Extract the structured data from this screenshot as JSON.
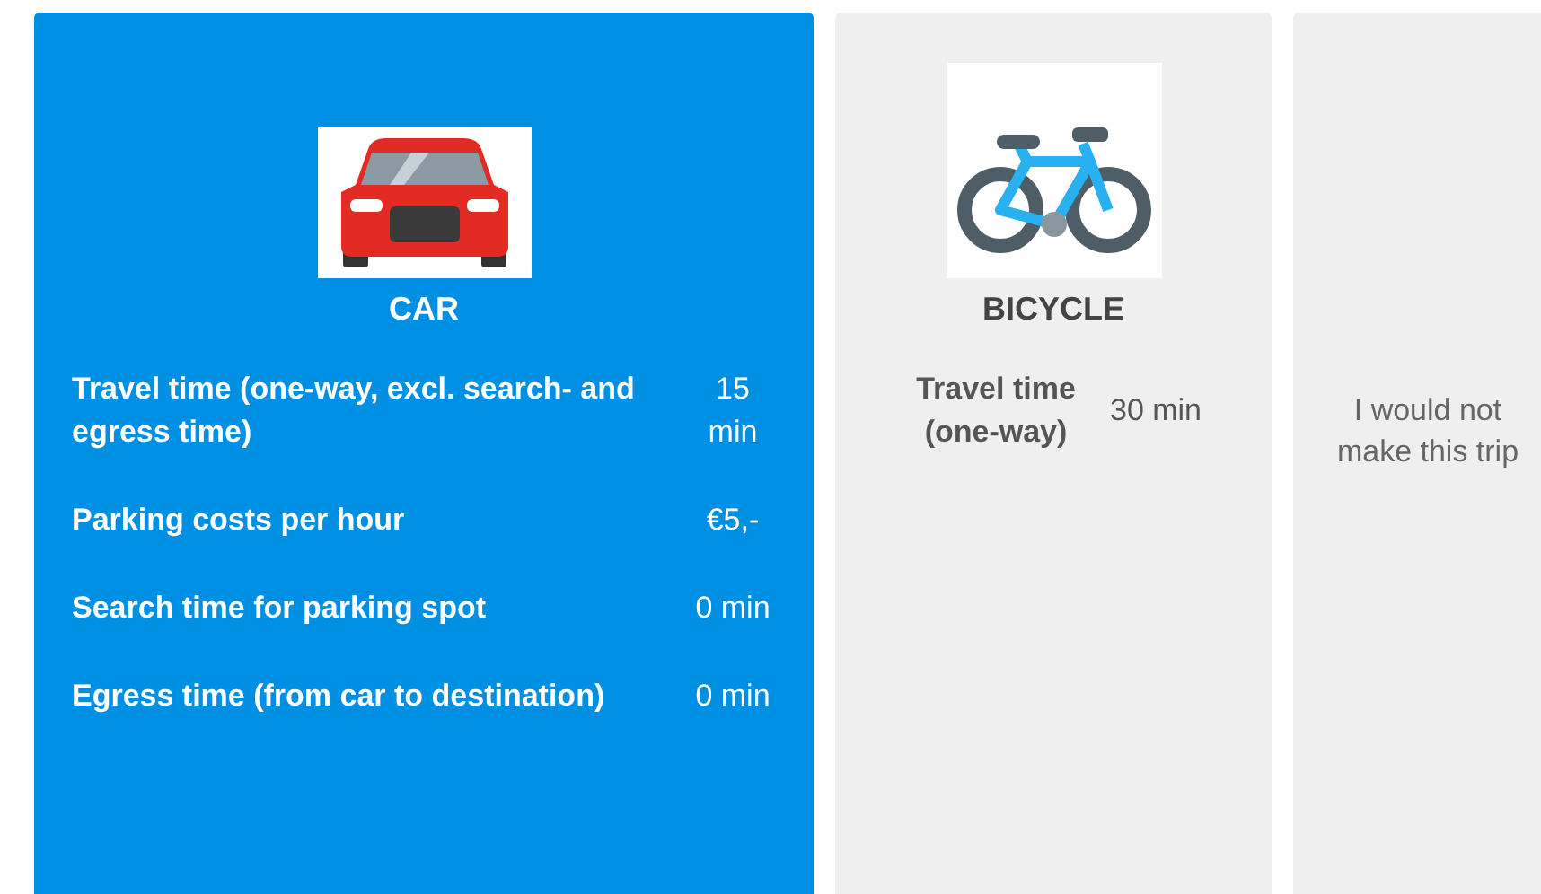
{
  "options": [
    {
      "kind": "attributes",
      "selected": true,
      "title": "CAR",
      "attributes": [
        {
          "label": "Travel time (one-way, excl. search- and egress time)",
          "value": "15 min"
        },
        {
          "label": "Parking costs per hour",
          "value": "€5,-"
        },
        {
          "label": "Search time for parking spot",
          "value": "0 min"
        },
        {
          "label": "Egress time (from car to destination)",
          "value": "0 min"
        }
      ]
    },
    {
      "kind": "attributes",
      "selected": false,
      "title": "BICYCLE",
      "attributes": [
        {
          "label": "Travel time (one-way)",
          "value": "30 min"
        }
      ]
    },
    {
      "kind": "message",
      "selected": false,
      "text": "I would not make this trip"
    }
  ]
}
